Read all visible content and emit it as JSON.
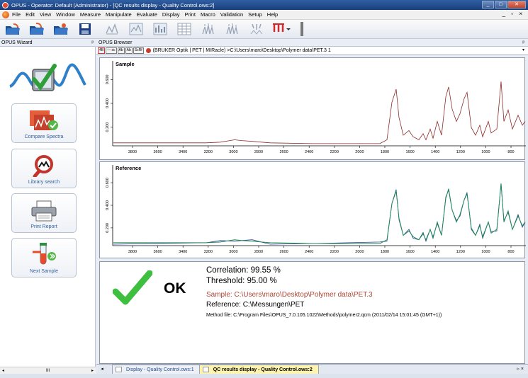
{
  "window": {
    "title": "OPUS - Operator: Default (Administrator) - [QC results display - Quality Control.ows:2]",
    "buttons": [
      "_",
      "□",
      "✕"
    ]
  },
  "menu": {
    "items": [
      "File",
      "Edit",
      "View",
      "Window",
      "Measure",
      "Manipulate",
      "Evaluate",
      "Display",
      "Print",
      "Macro",
      "Validation",
      "Setup",
      "Help"
    ],
    "right": "_ ▫ ×"
  },
  "toolbar": {
    "icons": [
      "open-folder-icon",
      "open-folder-icon",
      "open-folder-icon",
      "save-icon",
      "peak-pick-icon",
      "baseline-icon",
      "spectrum-icon",
      "table-icon",
      "peaks-icon",
      "peaks-icon",
      "peak-arrows-icon",
      "red-peaks-icon"
    ]
  },
  "wizard": {
    "title": "OPUS Wizard",
    "pin": "ᵖ",
    "buttons": [
      {
        "label": "Compare Spectra"
      },
      {
        "label": "Library search"
      },
      {
        "label": "Print Report"
      },
      {
        "label": "Next Sample"
      }
    ],
    "scroll": {
      "left": "◂",
      "mid": "III",
      "right": "▸"
    }
  },
  "browser": {
    "title": "OPUS Browser",
    "pin": "ᵖ",
    "file_buttons": [
      "4B",
      "⁓ sc",
      "Ab",
      "Ab",
      "ScRf"
    ],
    "path": "(BRUKER Optik | PET | MIRacle) >C:\\Users\\maro\\Desktop\\Polymer data\\PET.3  1",
    "dropdown": "▾"
  },
  "panels": {
    "sample_label": "Sample",
    "reference_label": "Reference",
    "x_ticks": [
      "3800",
      "3600",
      "3400",
      "3200",
      "3000",
      "2800",
      "2600",
      "2400",
      "2200",
      "2000",
      "1800",
      "1600",
      "1400",
      "1200",
      "1000",
      "800"
    ],
    "y_ticks": [
      "0.200",
      "0.400",
      "0.600"
    ]
  },
  "colors": {
    "sample_line": "#8c2a2a",
    "ref_green": "#1f8a5a",
    "ref_blue": "#2b3f8f",
    "check": "#3fbf3f",
    "sample_text": "#b04535"
  },
  "result": {
    "status": "OK",
    "correlation": "Correlation:  99.55 %",
    "threshold": "Threshold:  95.00 %",
    "sample": "Sample:  C:\\Users\\maro\\Desktop\\Polymer data\\PET.3",
    "reference": "Reference:  C:\\Messungen\\PET",
    "method": "Method file:  C:\\Program Files\\OPUS_7.0.105.1022\\Methods\\polymer2.qcm  (2011/02/14  15:01:45  (GMT+1))"
  },
  "tabs": [
    {
      "label": "Display - Quality Control.ows:1",
      "active": false
    },
    {
      "label": "QC results display - Quality Control.ows:2",
      "active": true
    }
  ],
  "tabnav": {
    "left": "◂",
    "close": "▹ ×"
  }
}
